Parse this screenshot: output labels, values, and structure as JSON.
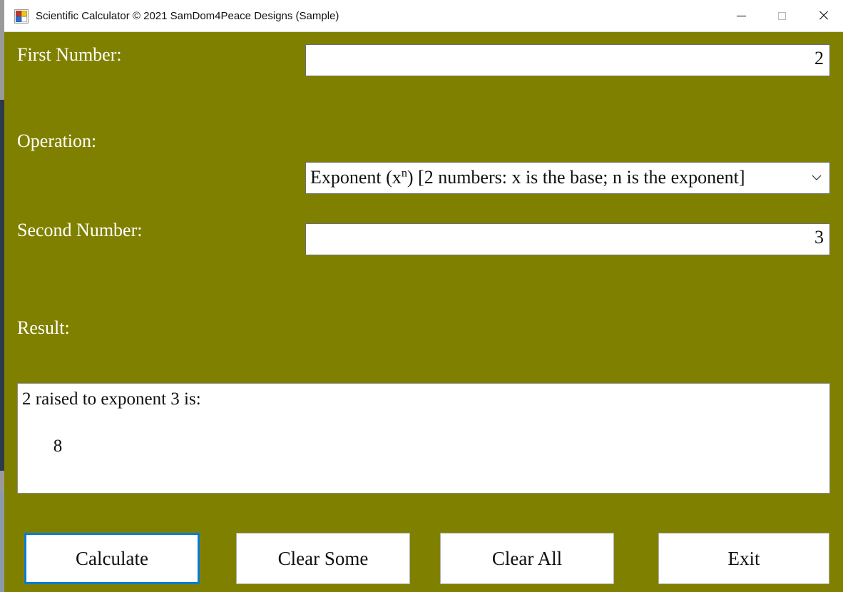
{
  "window": {
    "title": "Scientific Calculator © 2021 SamDom4Peace Designs (Sample)",
    "icon": "app-grid-icon",
    "background_color": "#808000",
    "controls": {
      "minimize": "minimize-icon",
      "maximize": "maximize-icon",
      "close": "close-icon"
    }
  },
  "form": {
    "first_number": {
      "label": "First Number:",
      "value": "2",
      "placeholder": ""
    },
    "operation": {
      "label": "Operation:",
      "selected_prefix": "Exponent (x",
      "selected_superscript": "n",
      "selected_suffix": ") [2 numbers: x is the base; n is the exponent]",
      "selected_value": "Exponent (xⁿ) [2 numbers: x is the base; n is the exponent]",
      "arrow": "⌄"
    },
    "second_number": {
      "label": "Second Number:",
      "value": "3",
      "placeholder": ""
    },
    "result": {
      "label": "Result:",
      "text": "2 raised to exponent 3 is:\n\n       8"
    }
  },
  "buttons": {
    "calculate": {
      "label": "Calculate",
      "focused": true,
      "focus_color": "#0a7bd4"
    },
    "clear_some": {
      "label": "Clear Some",
      "focused": false
    },
    "clear_all": {
      "label": "Clear All",
      "focused": false
    },
    "exit": {
      "label": "Exit",
      "focused": false
    }
  }
}
